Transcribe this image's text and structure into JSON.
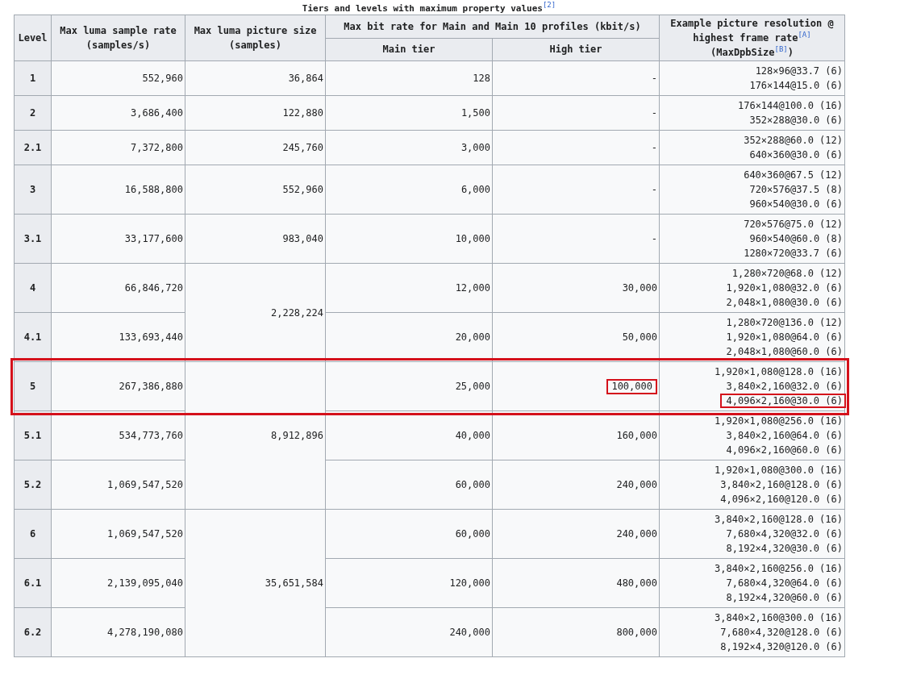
{
  "caption": "Tiers and levels with maximum property values$^{[2]}$",
  "columns": {
    "level": "Level",
    "sample_rate": "Max luma sample rate (samples/s)",
    "picture_size": "Max luma picture size (samples)",
    "bit_rate": "Max bit rate for Main and Main 10 profiles (kbit/s)",
    "main_tier": "Main tier",
    "high_tier": "High tier",
    "resolution": "Example picture resolution @ highest frame rate$^{[A]}$ (MaxDpbSize$^{[B]}$)"
  },
  "rows": [
    {
      "level": "1",
      "sample_rate": "552,960",
      "picture_size": "36,864",
      "main_tier": "128",
      "high_tier": "-",
      "marked": false,
      "high_tier_marked": false,
      "resolutions": [
        {
          "text": "128×96@33.7 (6)",
          "marked": false
        },
        {
          "text": "176×144@15.0 (6)",
          "marked": false
        }
      ]
    },
    {
      "level": "2",
      "sample_rate": "3,686,400",
      "picture_size": "122,880",
      "main_tier": "1,500",
      "high_tier": "-",
      "marked": false,
      "high_tier_marked": false,
      "resolutions": [
        {
          "text": "176×144@100.0 (16)",
          "marked": false
        },
        {
          "text": "352×288@30.0 (6)",
          "marked": false
        }
      ]
    },
    {
      "level": "2.1",
      "sample_rate": "7,372,800",
      "picture_size": "245,760",
      "main_tier": "3,000",
      "high_tier": "-",
      "marked": false,
      "high_tier_marked": false,
      "resolutions": [
        {
          "text": "352×288@60.0 (12)",
          "marked": false
        },
        {
          "text": "640×360@30.0 (6)",
          "marked": false
        }
      ]
    },
    {
      "level": "3",
      "sample_rate": "16,588,800",
      "picture_size": "552,960",
      "main_tier": "6,000",
      "high_tier": "-",
      "marked": false,
      "high_tier_marked": false,
      "resolutions": [
        {
          "text": "640×360@67.5 (12)",
          "marked": false
        },
        {
          "text": "720×576@37.5 (8)",
          "marked": false
        },
        {
          "text": "960×540@30.0 (6)",
          "marked": false
        }
      ]
    },
    {
      "level": "3.1",
      "sample_rate": "33,177,600",
      "picture_size": "983,040",
      "main_tier": "10,000",
      "high_tier": "-",
      "marked": false,
      "high_tier_marked": false,
      "resolutions": [
        {
          "text": "720×576@75.0 (12)",
          "marked": false
        },
        {
          "text": "960×540@60.0 (8)",
          "marked": false
        },
        {
          "text": "1280×720@33.7 (6)",
          "marked": false
        }
      ]
    },
    {
      "level": "4",
      "sample_rate": "66,846,720",
      "picture_size": "2,228,224",
      "main_tier": "12,000",
      "high_tier": "30,000",
      "marked": false,
      "high_tier_marked": false,
      "resolutions": [
        {
          "text": "1,280×720@68.0 (12)",
          "marked": false
        },
        {
          "text": "1,920×1,080@32.0 (6)",
          "marked": false
        },
        {
          "text": "2,048×1,080@30.0 (6)",
          "marked": false
        }
      ]
    },
    {
      "level": "4.1",
      "sample_rate": "133,693,440",
      "main_tier": "20,000",
      "high_tier": "50,000",
      "marked": false,
      "high_tier_marked": false,
      "resolutions": [
        {
          "text": "1,280×720@136.0 (12)",
          "marked": false
        },
        {
          "text": "1,920×1,080@64.0 (6)",
          "marked": false
        },
        {
          "text": "2,048×1,080@60.0 (6)",
          "marked": false
        }
      ]
    },
    {
      "level": "5",
      "sample_rate": "267,386,880",
      "picture_size": "8,912,896",
      "main_tier": "25,000",
      "high_tier": "100,000",
      "marked": true,
      "high_tier_marked": true,
      "resolutions": [
        {
          "text": "1,920×1,080@128.0 (16)",
          "marked": false
        },
        {
          "text": "3,840×2,160@32.0 (6)",
          "marked": false
        },
        {
          "text": "4,096×2,160@30.0 (6)",
          "marked": true
        }
      ]
    },
    {
      "level": "5.1",
      "sample_rate": "534,773,760",
      "main_tier": "40,000",
      "high_tier": "160,000",
      "marked": false,
      "high_tier_marked": false,
      "resolutions": [
        {
          "text": "1,920×1,080@256.0 (16)",
          "marked": false
        },
        {
          "text": "3,840×2,160@64.0 (6)",
          "marked": false
        },
        {
          "text": "4,096×2,160@60.0 (6)",
          "marked": false
        }
      ]
    },
    {
      "level": "5.2",
      "sample_rate": "1,069,547,520",
      "main_tier": "60,000",
      "high_tier": "240,000",
      "marked": false,
      "high_tier_marked": false,
      "resolutions": [
        {
          "text": "1,920×1,080@300.0 (16)",
          "marked": false
        },
        {
          "text": "3,840×2,160@128.0 (6)",
          "marked": false
        },
        {
          "text": "4,096×2,160@120.0 (6)",
          "marked": false
        }
      ]
    },
    {
      "level": "6",
      "sample_rate": "1,069,547,520",
      "picture_size": "35,651,584",
      "main_tier": "60,000",
      "high_tier": "240,000",
      "marked": false,
      "high_tier_marked": false,
      "resolutions": [
        {
          "text": "3,840×2,160@128.0 (16)",
          "marked": false
        },
        {
          "text": "7,680×4,320@32.0 (6)",
          "marked": false
        },
        {
          "text": "8,192×4,320@30.0 (6)",
          "marked": false
        }
      ]
    },
    {
      "level": "6.1",
      "sample_rate": "2,139,095,040",
      "main_tier": "120,000",
      "high_tier": "480,000",
      "marked": false,
      "high_tier_marked": false,
      "resolutions": [
        {
          "text": "3,840×2,160@256.0 (16)",
          "marked": false
        },
        {
          "text": "7,680×4,320@64.0 (6)",
          "marked": false
        },
        {
          "text": "8,192×4,320@60.0 (6)",
          "marked": false
        }
      ]
    },
    {
      "level": "6.2",
      "sample_rate": "4,278,190,080",
      "main_tier": "240,000",
      "high_tier": "800,000",
      "marked": false,
      "high_tier_marked": false,
      "resolutions": [
        {
          "text": "3,840×2,160@300.0 (16)",
          "marked": false
        },
        {
          "text": "7,680×4,320@128.0 (6)",
          "marked": false
        },
        {
          "text": "8,192×4,320@120.0 (6)",
          "marked": false
        }
      ]
    }
  ]
}
